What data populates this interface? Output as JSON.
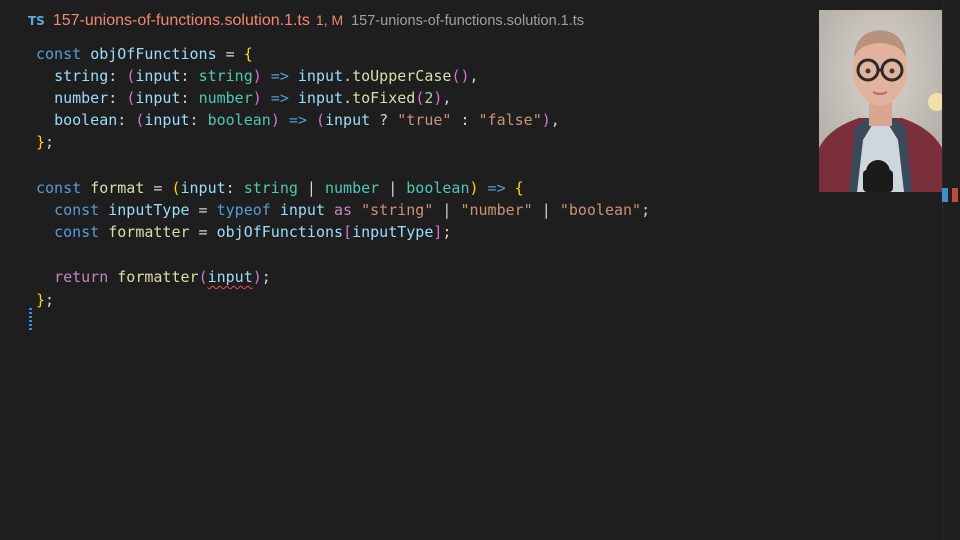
{
  "tab": {
    "badge": "TS",
    "filename": "157-unions-of-functions.solution.1.ts",
    "status": "1, M",
    "path": "157-unions-of-functions.solution.1.ts"
  },
  "code": {
    "l1": {
      "const": "const",
      "name": "objOfFunctions",
      "eq": " = ",
      "brace": "{"
    },
    "l2": {
      "key": "string",
      "colon": ": ",
      "po": "(",
      "param": "input",
      "pc": ": ",
      "ptype": "string",
      "pcl": ")",
      "arrow": " => ",
      "obj": "input",
      "dot": ".",
      "method": "toUpperCase",
      "call": "()",
      "comma": ","
    },
    "l3": {
      "key": "number",
      "colon": ": ",
      "po": "(",
      "param": "input",
      "pc": ": ",
      "ptype": "number",
      "pcl": ")",
      "arrow": " => ",
      "obj": "input",
      "dot": ".",
      "method": "toFixed",
      "co": "(",
      "arg": "2",
      "cc": ")",
      "comma": ","
    },
    "l4": {
      "key": "boolean",
      "colon": ": ",
      "po": "(",
      "param": "input",
      "pc": ": ",
      "ptype": "boolean",
      "pcl": ")",
      "arrow": " => ",
      "go": "(",
      "obj": "input",
      "q": " ? ",
      "s1": "\"true\"",
      "c": " : ",
      "s2": "\"false\"",
      "gc": ")",
      "comma": ","
    },
    "l5": {
      "brace": "}",
      "semi": ";"
    },
    "l7": {
      "const": "const",
      "name": "format",
      "eq": " = ",
      "po": "(",
      "param": "input",
      "pc": ": ",
      "t1": "string",
      "bar1": " | ",
      "t2": "number",
      "bar2": " | ",
      "t3": "boolean",
      "pcl": ")",
      "arrow": " => ",
      "brace": "{"
    },
    "l8": {
      "const": "const",
      "name": "inputType",
      "eq": " = ",
      "typeof": "typeof",
      "sp": " ",
      "var": "input",
      "sp2": " ",
      "as": "as",
      "sp3": " ",
      "s1": "\"string\"",
      "bar1": " | ",
      "s2": "\"number\"",
      "bar2": " | ",
      "s3": "\"boolean\"",
      "semi": ";"
    },
    "l9": {
      "const": "const",
      "name": "formatter",
      "eq": " = ",
      "obj": "objOfFunctions",
      "ko": "[",
      "key": "inputType",
      "kc": "]",
      "semi": ";"
    },
    "l11": {
      "return": "return",
      "sp": " ",
      "fn": "formatter",
      "po": "(",
      "arg": "input",
      "pc": ")",
      "semi": ";"
    },
    "l12": {
      "brace": "}",
      "semi": ";"
    }
  }
}
